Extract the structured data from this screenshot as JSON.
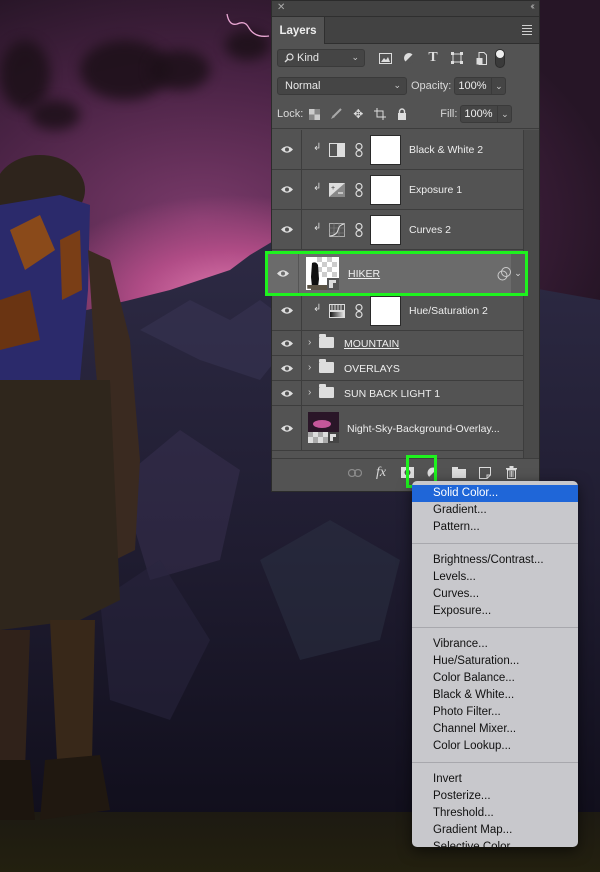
{
  "panel": {
    "title": "Layers",
    "filter": {
      "kind_label": "Kind",
      "icons": [
        "image-filter-icon",
        "adjustment-filter-icon",
        "type-filter-icon",
        "shape-filter-icon",
        "smart-object-filter-icon"
      ]
    },
    "blend_mode": "Normal",
    "opacity_label": "Opacity:",
    "opacity_value": "100%",
    "lock_label": "Lock:",
    "fill_label": "Fill:",
    "fill_value": "100%"
  },
  "layers": [
    {
      "name": "Black & White 2",
      "type": "adjustment",
      "clipped": true,
      "visible": true
    },
    {
      "name": "Exposure 1",
      "type": "adjustment",
      "clipped": true,
      "visible": true
    },
    {
      "name": "Curves 2",
      "type": "adjustment",
      "clipped": true,
      "visible": true
    },
    {
      "name": "HIKER",
      "type": "smart-object",
      "selected": true,
      "visible": true
    },
    {
      "name": "Hue/Saturation 2",
      "type": "adjustment",
      "clipped": true,
      "visible": true
    },
    {
      "name": "MOUNTAIN",
      "type": "group",
      "visible": true
    },
    {
      "name": "OVERLAYS",
      "type": "group",
      "visible": true
    },
    {
      "name": "SUN BACK LIGHT 1",
      "type": "group",
      "visible": true
    },
    {
      "name": "Night-Sky-Background-Overlay...",
      "type": "smart-object",
      "visible": true
    }
  ],
  "footer_buttons": [
    "link-layers",
    "add-layer-style",
    "add-mask",
    "new-fill-adjustment-layer",
    "new-group",
    "new-layer",
    "delete-layer"
  ],
  "menu": {
    "groups": [
      [
        "Solid Color...",
        "Gradient...",
        "Pattern..."
      ],
      [
        "Brightness/Contrast...",
        "Levels...",
        "Curves...",
        "Exposure..."
      ],
      [
        "Vibrance...",
        "Hue/Saturation...",
        "Color Balance...",
        "Black & White...",
        "Photo Filter...",
        "Channel Mixer...",
        "Color Lookup..."
      ],
      [
        "Invert",
        "Posterize...",
        "Threshold...",
        "Gradient Map...",
        "Selective Color..."
      ]
    ],
    "highlighted": "Solid Color..."
  },
  "colors": {
    "highlight_green": "#1ef21e",
    "menu_selection": "#1f66d8",
    "panel_bg": "#535353"
  }
}
